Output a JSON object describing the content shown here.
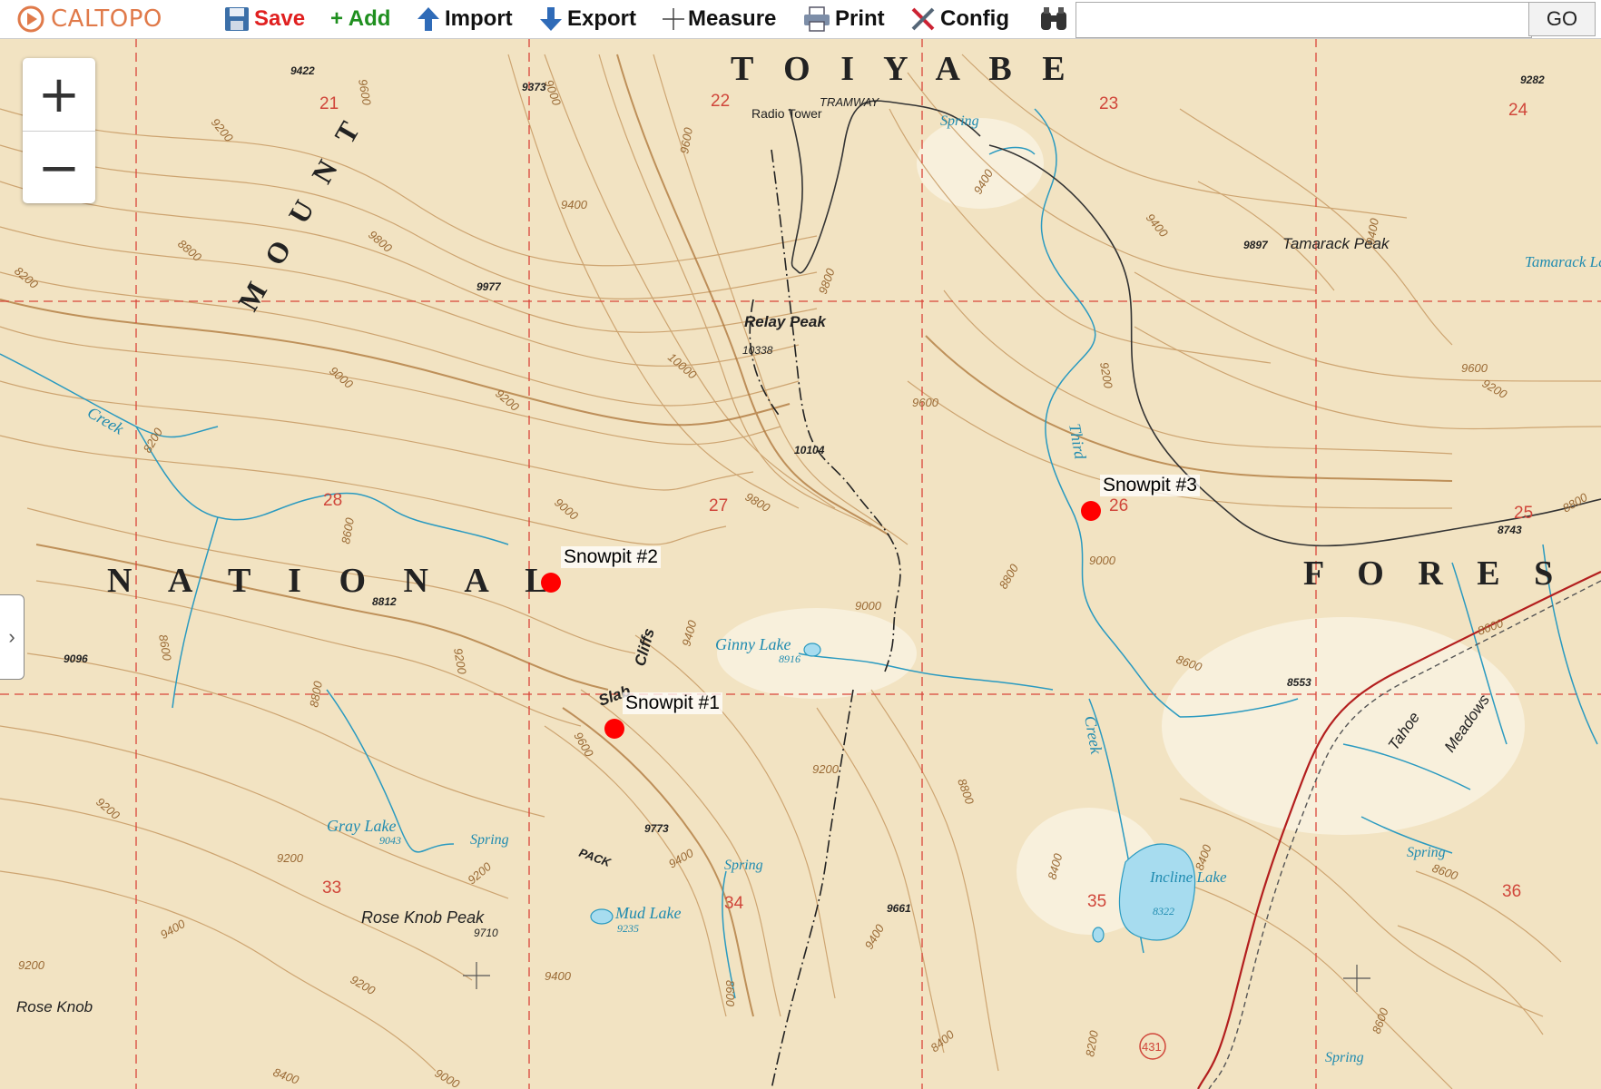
{
  "toolbar": {
    "logo_text": "CALTOPO",
    "save_label": "Save",
    "add_label": "+ Add",
    "import_label": "Import",
    "export_label": "Export",
    "measure_label": "Measure",
    "print_label": "Print",
    "config_label": "Config",
    "search_value": "",
    "go_label": "GO"
  },
  "zoom": {
    "in_label": "+",
    "out_label": "−"
  },
  "markers": [
    {
      "name": "Snowpit #1"
    },
    {
      "name": "Snowpit #2"
    },
    {
      "name": "Snowpit #3"
    }
  ],
  "map_labels": {
    "region_toiyabe": "T O I Y A B E",
    "region_national": "N A T I O N A L",
    "region_forest": "F O R E S",
    "mount": "M O U N T",
    "tramway": "TRAMWAY",
    "radio_tower": "Radio Tower",
    "relay_peak": "Relay Peak",
    "relay_peak_elev": "10338",
    "tamarack_peak": "Tamarack Peak",
    "tamarack_elev": "9897",
    "tamarack_lake": "Tamarack Lake",
    "third_creek_1": "Third",
    "third_creek_2": "Creek",
    "creek": "Creek",
    "ginny_lake": "Ginny Lake",
    "ginny_elev": "8916",
    "slab_cliffs_1": "Slab",
    "slab_cliffs_2": "Cliffs",
    "gray_lake": "Gray Lake",
    "gray_elev": "9043",
    "spring": "Spring",
    "pack": "PACK",
    "mud_lake": "Mud Lake",
    "mud_elev": "9235",
    "rose_knob_peak": "Rose  Knob  Peak",
    "rose_knob_elev": "9710",
    "rose_knob": "Rose Knob",
    "incline_lake": "Incline Lake",
    "incline_elev": "8322",
    "tahoe_meadows_1": "Tahoe",
    "tahoe_meadows_2": "Meadows",
    "route_431": "431",
    "section_21": "21",
    "section_22": "22",
    "section_23": "23",
    "section_24": "24",
    "section_25": "25",
    "section_26": "26",
    "section_27": "27",
    "section_28": "28",
    "section_33": "33",
    "section_34": "34",
    "section_35": "35",
    "section_36": "36",
    "elev_9422": "9422",
    "elev_9373": "9373",
    "elev_9282": "9282",
    "elev_9977": "9977",
    "elev_10104": "10104",
    "elev_8812": "8812",
    "elev_9096": "9096",
    "elev_9773": "9773",
    "elev_9661": "9661",
    "elev_8553": "8553",
    "elev_8743": "8743",
    "c_9200": "9200",
    "c_9000": "9000",
    "c_9400": "9400",
    "c_9600": "9600",
    "c_9800": "9800",
    "c_10000": "10000",
    "c_8800": "8800",
    "c_8600": "8600",
    "c_8400": "8400",
    "c_8200": "8200"
  }
}
